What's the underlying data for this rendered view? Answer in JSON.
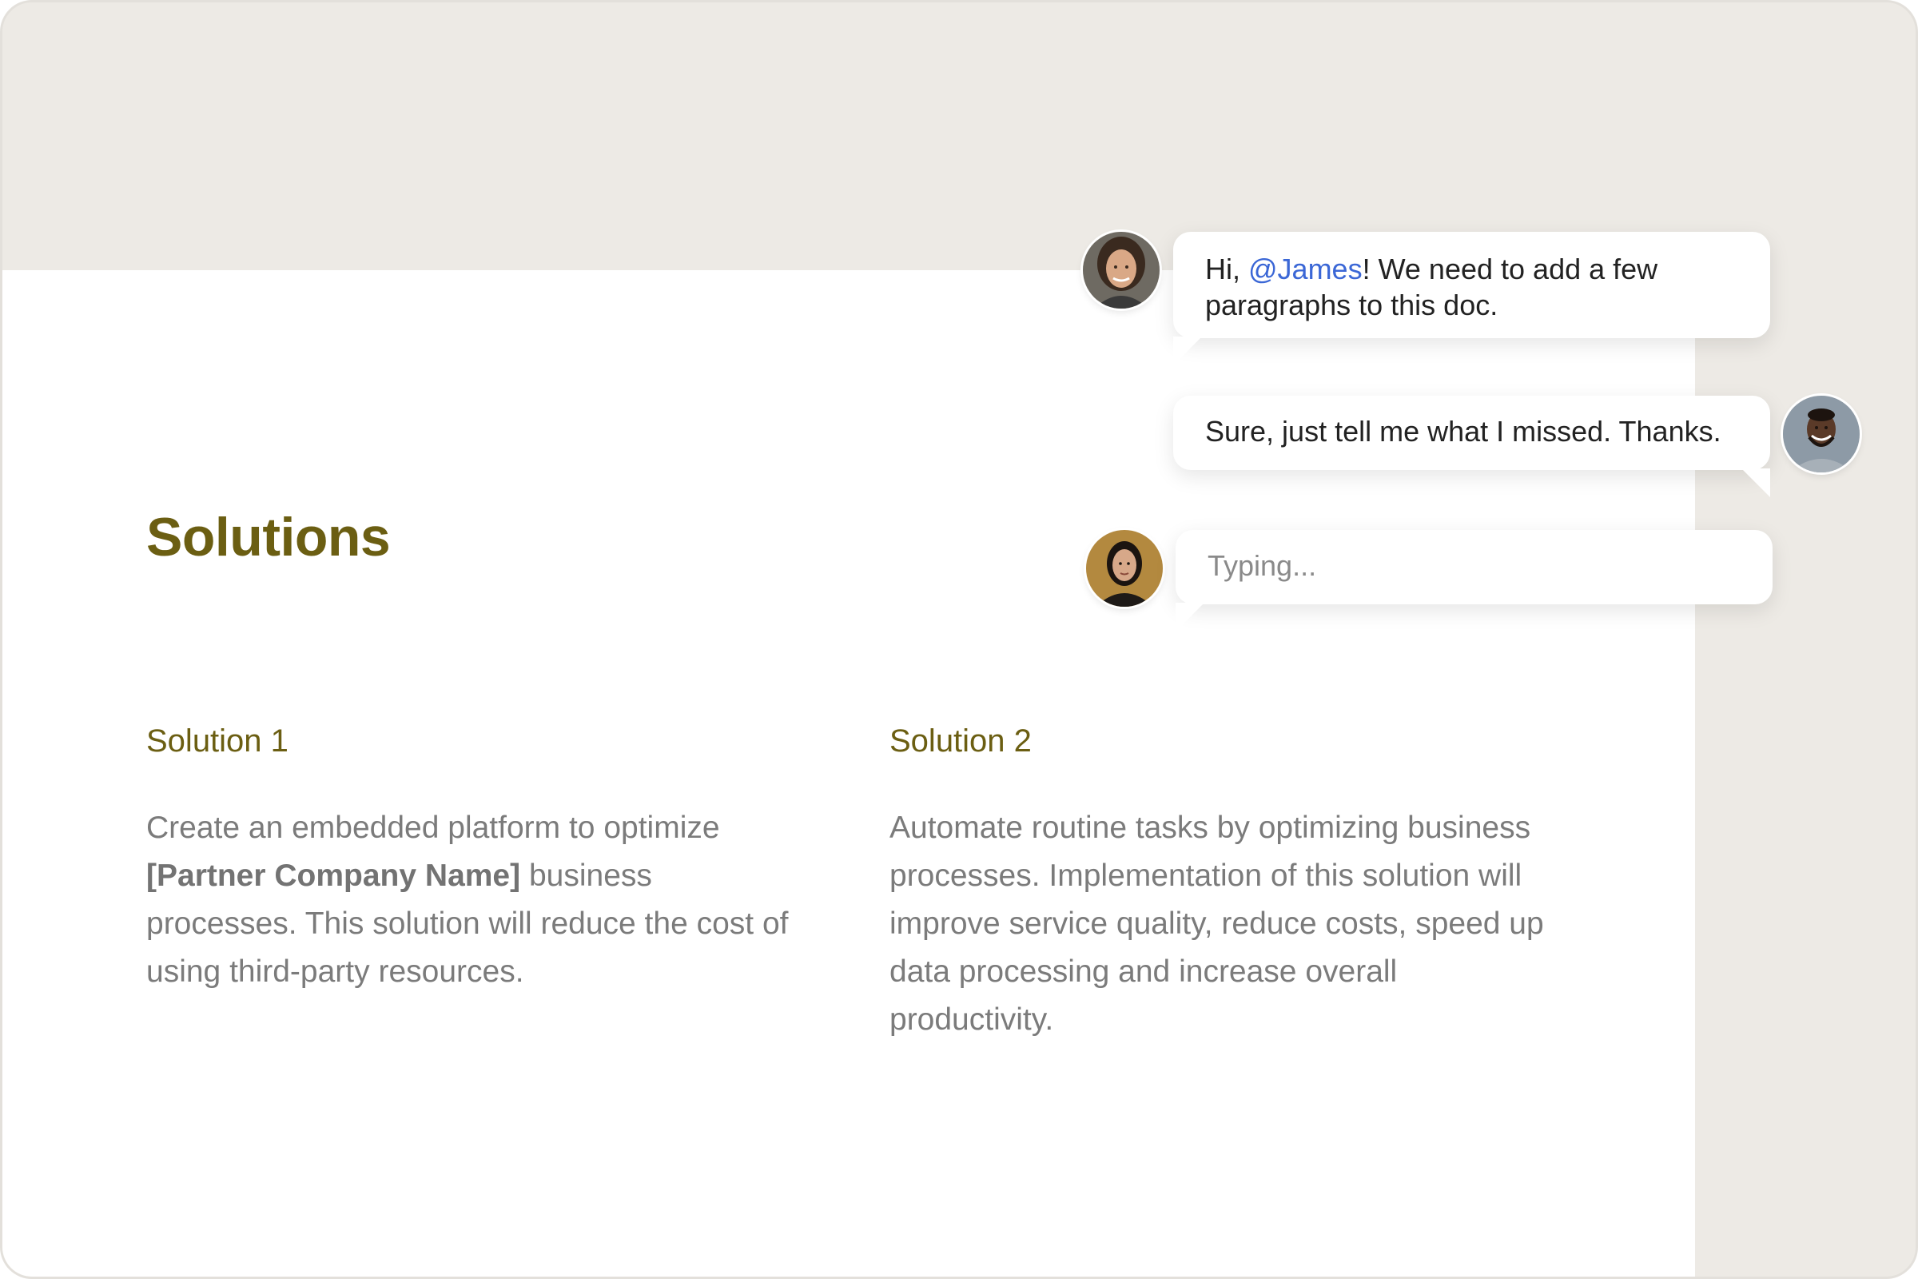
{
  "document": {
    "title": "Solutions",
    "columns": [
      {
        "heading": "Solution 1",
        "body_before": "Create an embedded platform to optimize ",
        "body_bold": "[Partner Company Name]",
        "body_after": " business processes. This solution will reduce the cost of using third-party resources."
      },
      {
        "heading": "Solution 2",
        "body": "Automate routine tasks by optimizing business processes. Implementation of this solution will improve service quality, reduce costs, speed up data processing and increase overall productivity."
      }
    ]
  },
  "chat": {
    "messages": [
      {
        "avatar": "woman-avatar",
        "text_before": "Hi, ",
        "mention": "@James",
        "text_after": "! We need to add a few paragraphs to this doc."
      },
      {
        "avatar": "man-avatar",
        "text": "Sure, just tell me what I missed. Thanks."
      },
      {
        "avatar": "woman-avatar-2",
        "text": "Typing..."
      }
    ]
  },
  "colors": {
    "background": "#edeae5",
    "heading": "#6b5e12",
    "body_text": "#7b7b7b",
    "mention": "#3b67d6"
  }
}
